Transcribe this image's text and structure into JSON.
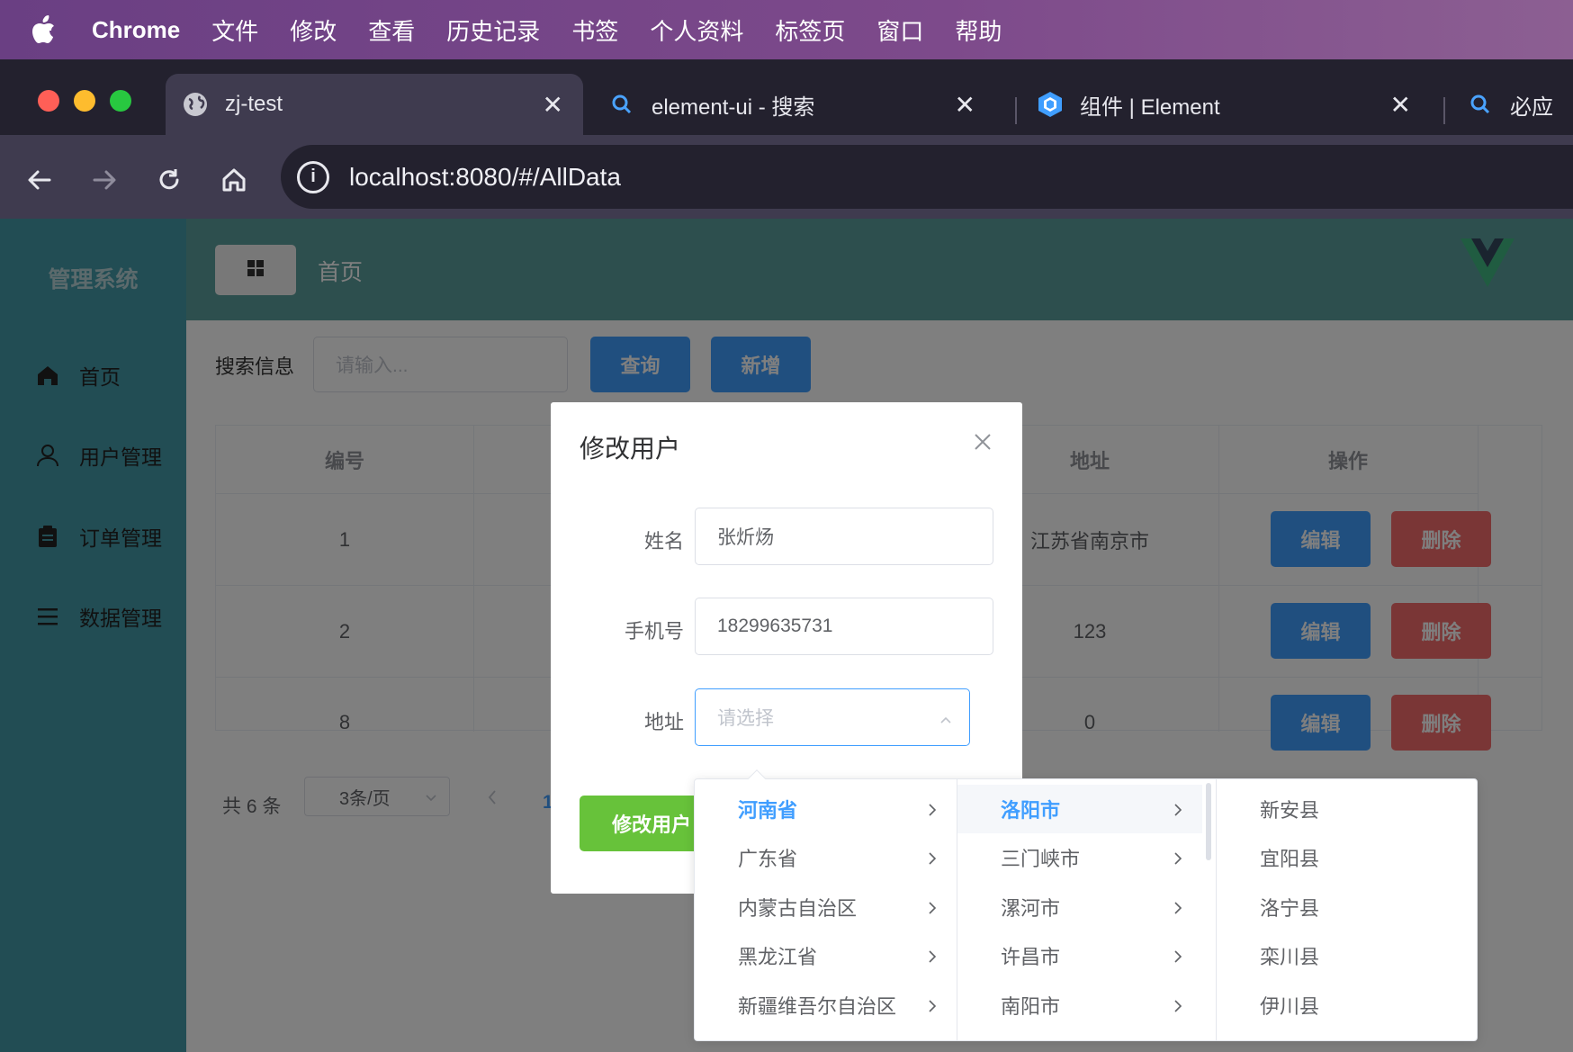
{
  "menubar": {
    "app_name": "Chrome",
    "items": [
      "文件",
      "修改",
      "查看",
      "历史记录",
      "书签",
      "个人资料",
      "标签页",
      "窗口",
      "帮助"
    ]
  },
  "browser": {
    "tabs": [
      {
        "title": "zj-test",
        "icon": "globe-icon",
        "active": true
      },
      {
        "title": "element-ui - 搜索",
        "icon": "search-icon",
        "active": false
      },
      {
        "title": "组件 | Element",
        "icon": "element-logo-icon",
        "active": false
      },
      {
        "title": "必应",
        "icon": "search-icon",
        "active": false
      }
    ],
    "url": "localhost:8080/#/AllData"
  },
  "sidebar": {
    "brand": "管理系统",
    "items": [
      {
        "label": "首页",
        "icon": "home-icon"
      },
      {
        "label": "用户管理",
        "icon": "user-icon"
      },
      {
        "label": "订单管理",
        "icon": "clipboard-icon"
      },
      {
        "label": "数据管理",
        "icon": "list-icon"
      }
    ]
  },
  "header": {
    "title": "首页",
    "logo": "vue-logo-icon"
  },
  "search": {
    "label": "搜索信息",
    "placeholder": "请输入...",
    "query_button": "查询",
    "add_button": "新增"
  },
  "table": {
    "columns": [
      "编号",
      "地址",
      "操作"
    ],
    "rows": [
      {
        "id": "1",
        "address": "江苏省南京市"
      },
      {
        "id": "2",
        "address": "123"
      },
      {
        "id": "8",
        "address": "0"
      }
    ],
    "edit_label": "编辑",
    "delete_label": "删除"
  },
  "pagination": {
    "total": "共 6 条",
    "page_size": "3条/页",
    "current_page": "1"
  },
  "dialog": {
    "title": "修改用户",
    "fields": {
      "name_label": "姓名",
      "name_value": "张炘炀",
      "phone_label": "手机号",
      "phone_value": "18299635731",
      "address_label": "地址",
      "address_placeholder": "请选择"
    },
    "submit_button": "修改用户"
  },
  "cascader": {
    "provinces": [
      "河南省",
      "广东省",
      "内蒙古自治区",
      "黑龙江省",
      "新疆维吾尔自治区"
    ],
    "cities": [
      "洛阳市",
      "三门峡市",
      "漯河市",
      "许昌市",
      "南阳市"
    ],
    "counties": [
      "新安县",
      "宜阳县",
      "洛宁县",
      "栾川县",
      "伊川县"
    ],
    "selected_province": "河南省",
    "selected_city": "洛阳市"
  },
  "colors": {
    "primary": "#409eff",
    "danger": "#f56c6c",
    "success": "#67c23a",
    "sidebar": "#449aa9",
    "header": "#5b9f9c"
  }
}
